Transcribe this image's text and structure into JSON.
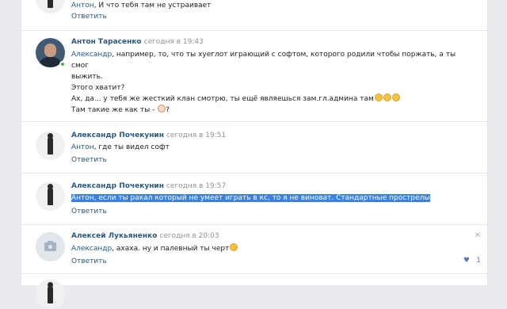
{
  "comments": [
    {
      "author": "",
      "time": "",
      "text_addr": "Антон",
      "text_body": ", И что тебя там не устраивает",
      "reply_label": "Ответить"
    },
    {
      "author": "Антон Тарасенко",
      "time": "сегодня в 19:43",
      "text_addr": "Александр",
      "text_line1": ", например, то, что ты хуеглот играющий с софтом, которого родили чтобы поржать, а ты смог",
      "text_line2": "выжить.",
      "text_line3": "Этого хватит?",
      "text_line4": "Ах, да... у тебя же жесткий клан смотрю, ты ещё являешься зам.гл.админа там",
      "text_line5": "Там такие же как ты - ",
      "text_line5_end": "?"
    },
    {
      "author": "Александр Почекунин",
      "time": "сегодня в 19:51",
      "text_addr": "Антон",
      "text_body": ", где ты видел софт",
      "reply_label": "Ответить"
    },
    {
      "author": "Александр Почекунин",
      "time": "сегодня в 19:57",
      "text_highlighted": "Антон, если ты ракал который не умеет играть в кс, то я не виноват. Стандартные прострелы",
      "reply_label": "Ответить"
    },
    {
      "author": "Алексей Лукьяненко",
      "time": "сегодня в 20:03",
      "text_addr": "Александр",
      "text_body": ", ахаха. ну и палевный ты черт",
      "reply_label": "Ответить",
      "close_glyph": "✕",
      "likes": "1"
    }
  ],
  "icons": {
    "heart": "♥"
  }
}
